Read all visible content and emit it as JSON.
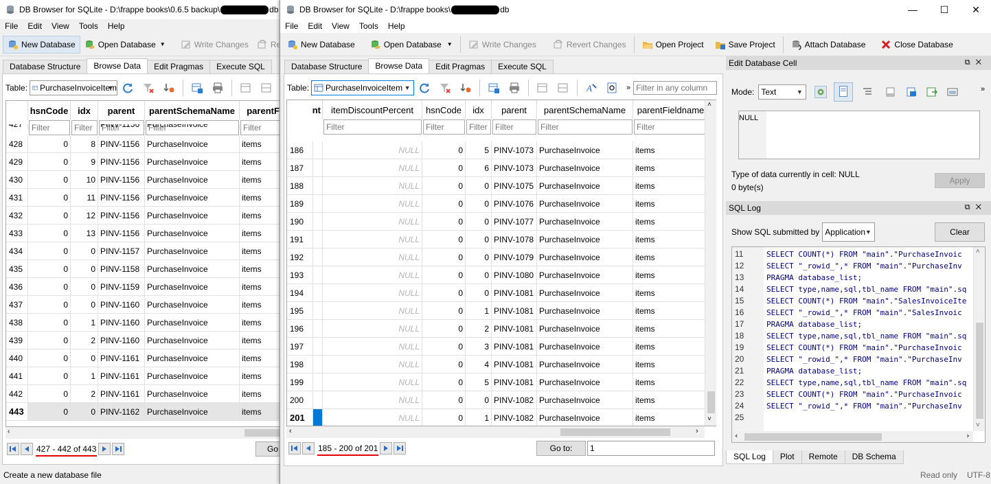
{
  "w1": {
    "title_prefix": "DB Browser for SQLite - D:\\frappe books\\0.6.5 backup\\",
    "title_suffix": "db",
    "menu": [
      "File",
      "Edit",
      "View",
      "Tools",
      "Help"
    ],
    "toolbar": {
      "new_db": "New Database",
      "open_db": "Open Database",
      "write": "Write Changes",
      "revert": "Revert"
    },
    "tabs": [
      "Database Structure",
      "Browse Data",
      "Edit Pragmas",
      "Execute SQL"
    ],
    "table_label": "Table:",
    "table_value": "PurchaseInvoiceItem",
    "columns": [
      "hsnCode",
      "idx",
      "parent",
      "parentSchemaName",
      "parentFie"
    ],
    "filter_placeholder": "Filter",
    "rows": [
      {
        "n": "428",
        "hsn": "0",
        "idx": "8",
        "parent": "PINV-1156",
        "schema": "PurchaseInvoice",
        "field": "items"
      },
      {
        "n": "429",
        "hsn": "0",
        "idx": "9",
        "parent": "PINV-1156",
        "schema": "PurchaseInvoice",
        "field": "items"
      },
      {
        "n": "430",
        "hsn": "0",
        "idx": "10",
        "parent": "PINV-1156",
        "schema": "PurchaseInvoice",
        "field": "items"
      },
      {
        "n": "431",
        "hsn": "0",
        "idx": "11",
        "parent": "PINV-1156",
        "schema": "PurchaseInvoice",
        "field": "items"
      },
      {
        "n": "432",
        "hsn": "0",
        "idx": "12",
        "parent": "PINV-1156",
        "schema": "PurchaseInvoice",
        "field": "items"
      },
      {
        "n": "433",
        "hsn": "0",
        "idx": "13",
        "parent": "PINV-1156",
        "schema": "PurchaseInvoice",
        "field": "items"
      },
      {
        "n": "434",
        "hsn": "0",
        "idx": "0",
        "parent": "PINV-1157",
        "schema": "PurchaseInvoice",
        "field": "items"
      },
      {
        "n": "435",
        "hsn": "0",
        "idx": "0",
        "parent": "PINV-1158",
        "schema": "PurchaseInvoice",
        "field": "items"
      },
      {
        "n": "436",
        "hsn": "0",
        "idx": "0",
        "parent": "PINV-1159",
        "schema": "PurchaseInvoice",
        "field": "items"
      },
      {
        "n": "437",
        "hsn": "0",
        "idx": "0",
        "parent": "PINV-1160",
        "schema": "PurchaseInvoice",
        "field": "items"
      },
      {
        "n": "438",
        "hsn": "0",
        "idx": "1",
        "parent": "PINV-1160",
        "schema": "PurchaseInvoice",
        "field": "items"
      },
      {
        "n": "439",
        "hsn": "0",
        "idx": "2",
        "parent": "PINV-1160",
        "schema": "PurchaseInvoice",
        "field": "items"
      },
      {
        "n": "440",
        "hsn": "0",
        "idx": "0",
        "parent": "PINV-1161",
        "schema": "PurchaseInvoice",
        "field": "items"
      },
      {
        "n": "441",
        "hsn": "0",
        "idx": "1",
        "parent": "PINV-1161",
        "schema": "PurchaseInvoice",
        "field": "items"
      },
      {
        "n": "442",
        "hsn": "0",
        "idx": "2",
        "parent": "PINV-1161",
        "schema": "PurchaseInvoice",
        "field": "items"
      },
      {
        "n": "443",
        "hsn": "0",
        "idx": "0",
        "parent": "PINV-1162",
        "schema": "PurchaseInvoice",
        "field": "items"
      }
    ],
    "partial_row": {
      "n": "427",
      "parent": "PINV-1156",
      "schema": "PurchaseInvoice"
    },
    "record_label": "427 - 442 of 443",
    "goto_label": "Go",
    "status": "Create a new database file"
  },
  "w2": {
    "title_prefix": "DB Browser for SQLite - D:\\frappe books\\",
    "title_suffix": "db",
    "window_controls": {
      "minimize": "—",
      "maximize": "☐",
      "close": "✕"
    },
    "menu": [
      "File",
      "Edit",
      "View",
      "Tools",
      "Help"
    ],
    "toolbar": {
      "new_db": "New Database",
      "open_db": "Open Database",
      "write": "Write Changes",
      "revert": "Revert Changes",
      "open_project": "Open Project",
      "save_project": "Save Project",
      "attach": "Attach Database",
      "close": "Close Database"
    },
    "tabs": [
      "Database Structure",
      "Browse Data",
      "Edit Pragmas",
      "Execute SQL"
    ],
    "table_label": "Table:",
    "table_value": "PurchaseInvoiceItem",
    "filter_any_placeholder": "Filter in any column",
    "first_col_header": "nt",
    "columns": [
      "itemDiscountPercent",
      "hsnCode",
      "idx",
      "parent",
      "parentSchemaName",
      "parentFieldname"
    ],
    "filter_placeholder": "Filter",
    "rows": [
      {
        "n": "186",
        "disc": "NULL",
        "hsn": "0",
        "idx": "5",
        "parent": "PINV-1073",
        "schema": "PurchaseInvoice",
        "field": "items"
      },
      {
        "n": "187",
        "disc": "NULL",
        "hsn": "0",
        "idx": "6",
        "parent": "PINV-1073",
        "schema": "PurchaseInvoice",
        "field": "items"
      },
      {
        "n": "188",
        "disc": "NULL",
        "hsn": "0",
        "idx": "0",
        "parent": "PINV-1075",
        "schema": "PurchaseInvoice",
        "field": "items"
      },
      {
        "n": "189",
        "disc": "NULL",
        "hsn": "0",
        "idx": "0",
        "parent": "PINV-1076",
        "schema": "PurchaseInvoice",
        "field": "items"
      },
      {
        "n": "190",
        "disc": "NULL",
        "hsn": "0",
        "idx": "0",
        "parent": "PINV-1077",
        "schema": "PurchaseInvoice",
        "field": "items"
      },
      {
        "n": "191",
        "disc": "NULL",
        "hsn": "0",
        "idx": "0",
        "parent": "PINV-1078",
        "schema": "PurchaseInvoice",
        "field": "items"
      },
      {
        "n": "192",
        "disc": "NULL",
        "hsn": "0",
        "idx": "0",
        "parent": "PINV-1079",
        "schema": "PurchaseInvoice",
        "field": "items"
      },
      {
        "n": "193",
        "disc": "NULL",
        "hsn": "0",
        "idx": "0",
        "parent": "PINV-1080",
        "schema": "PurchaseInvoice",
        "field": "items"
      },
      {
        "n": "194",
        "disc": "NULL",
        "hsn": "0",
        "idx": "0",
        "parent": "PINV-1081",
        "schema": "PurchaseInvoice",
        "field": "items"
      },
      {
        "n": "195",
        "disc": "NULL",
        "hsn": "0",
        "idx": "1",
        "parent": "PINV-1081",
        "schema": "PurchaseInvoice",
        "field": "items"
      },
      {
        "n": "196",
        "disc": "NULL",
        "hsn": "0",
        "idx": "2",
        "parent": "PINV-1081",
        "schema": "PurchaseInvoice",
        "field": "items"
      },
      {
        "n": "197",
        "disc": "NULL",
        "hsn": "0",
        "idx": "3",
        "parent": "PINV-1081",
        "schema": "PurchaseInvoice",
        "field": "items"
      },
      {
        "n": "198",
        "disc": "NULL",
        "hsn": "0",
        "idx": "4",
        "parent": "PINV-1081",
        "schema": "PurchaseInvoice",
        "field": "items"
      },
      {
        "n": "199",
        "disc": "NULL",
        "hsn": "0",
        "idx": "5",
        "parent": "PINV-1081",
        "schema": "PurchaseInvoice",
        "field": "items"
      },
      {
        "n": "200",
        "disc": "NULL",
        "hsn": "0",
        "idx": "0",
        "parent": "PINV-1082",
        "schema": "PurchaseInvoice",
        "field": "items"
      },
      {
        "n": "201",
        "disc": "NULL",
        "hsn": "0",
        "idx": "1",
        "parent": "PINV-1082",
        "schema": "PurchaseInvoice",
        "field": "items"
      }
    ],
    "record_label": "185 - 200 of 201",
    "goto_label": "Go to:",
    "goto_value": "1",
    "edit_cell": {
      "title": "Edit Database Cell",
      "mode_label": "Mode:",
      "mode_value": "Text",
      "content": "NULL",
      "type_info": "Type of data currently in cell: NULL",
      "size_info": "0 byte(s)",
      "apply": "Apply"
    },
    "sql_log": {
      "title": "SQL Log",
      "show_label": "Show SQL submitted by",
      "show_value": "Application",
      "clear": "Clear",
      "lines": [
        {
          "n": "11",
          "t": "SELECT COUNT(*) FROM \"main\".\"PurchaseInvoic"
        },
        {
          "n": "12",
          "t": "SELECT \"_rowid_\",* FROM \"main\".\"PurchaseInv"
        },
        {
          "n": "13",
          "t": "PRAGMA database_list;"
        },
        {
          "n": "14",
          "t": "SELECT type,name,sql,tbl_name FROM \"main\".sq"
        },
        {
          "n": "15",
          "t": "SELECT COUNT(*) FROM \"main\".\"SalesInvoiceIte"
        },
        {
          "n": "16",
          "t": "SELECT \"_rowid_\",* FROM \"main\".\"SalesInvoic"
        },
        {
          "n": "17",
          "t": "PRAGMA database_list;"
        },
        {
          "n": "18",
          "t": "SELECT type,name,sql,tbl_name FROM \"main\".sq"
        },
        {
          "n": "19",
          "t": "SELECT COUNT(*) FROM \"main\".\"PurchaseInvoic"
        },
        {
          "n": "20",
          "t": "SELECT \"_rowid_\",* FROM \"main\".\"PurchaseInv"
        },
        {
          "n": "21",
          "t": "PRAGMA database_list;"
        },
        {
          "n": "22",
          "t": "SELECT type,name,sql,tbl_name FROM \"main\".sq"
        },
        {
          "n": "23",
          "t": "SELECT COUNT(*) FROM \"main\".\"PurchaseInvoic"
        },
        {
          "n": "24",
          "t": "SELECT \"_rowid_\",* FROM \"main\".\"PurchaseInv"
        },
        {
          "n": "25",
          "t": ""
        }
      ]
    },
    "bottom_tabs": [
      "SQL Log",
      "Plot",
      "Remote",
      "DB Schema"
    ],
    "status_readonly": "Read only",
    "status_encoding": "UTF-8"
  },
  "colors": {
    "accent": "#0078d7",
    "red": "#e00000",
    "null_text": "#b5b5b5",
    "keyword": "#00008b",
    "string": "#008000"
  }
}
